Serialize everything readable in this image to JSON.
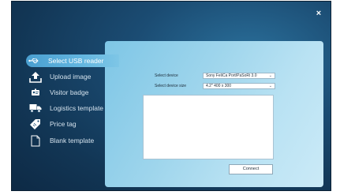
{
  "window": {
    "close_symbol": "×"
  },
  "sidebar": {
    "items": [
      {
        "label": "Select USB reader",
        "icon": "usb-icon",
        "active": true
      },
      {
        "label": "Upload image",
        "icon": "upload-icon",
        "active": false
      },
      {
        "label": "Visitor badge",
        "icon": "badge-icon",
        "active": false
      },
      {
        "label": "Logistics template",
        "icon": "truck-icon",
        "active": false
      },
      {
        "label": "Price tag",
        "icon": "tag-icon",
        "active": false
      },
      {
        "label": "Blank template",
        "icon": "document-icon",
        "active": false
      }
    ]
  },
  "form": {
    "device_label": "Select device",
    "device_value": "Sony FeliCa Port/PaSoRi 3.0",
    "size_label": "Select device size",
    "size_value": "4.2\" 400 x 300"
  },
  "actions": {
    "connect_label": "Connect"
  },
  "colors": {
    "accent": "#63b6e0",
    "background": "#123655",
    "panel": "#9ed5ec"
  }
}
